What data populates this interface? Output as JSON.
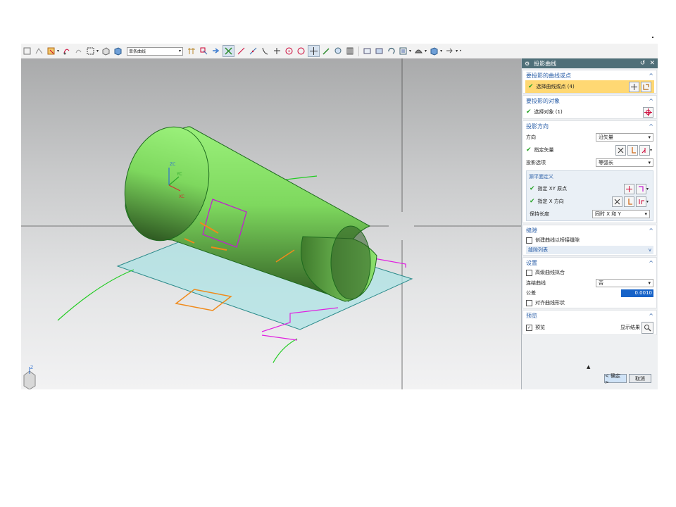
{
  "toolbar": {
    "curve_filter": "单条曲线",
    "icons": [
      "move-icon",
      "snap-icon",
      "select-icon",
      "rotate-icon",
      "redo-icon",
      "box-select-icon",
      "shading-icon",
      "cube-icon",
      "grid-icon",
      "snap-point-icon",
      "arrow-icon",
      "vertex-select-icon",
      "line-icon",
      "line2-icon",
      "curve-icon",
      "arc-icon",
      "circle-point-icon",
      "circle-icon",
      "cross-icon",
      "edit-icon",
      "refresh-icon",
      "layer-icon",
      "zoom-icon",
      "view-icon",
      "rotate-view-icon",
      "fit-icon",
      "render-icon",
      "box-icon",
      "more-icon"
    ]
  },
  "dialog": {
    "title": "投影曲线",
    "reset": "↺",
    "close": "✕",
    "section_curves": {
      "title": "要投影的曲线或点",
      "select_label": "选择曲线或点 (4)"
    },
    "section_objects": {
      "title": "要投影的对象",
      "select_label": "选择对象 (1)"
    },
    "section_direction": {
      "title": "投影方向",
      "direction_label": "方向",
      "direction_value": "沿矢量",
      "vector_label": "指定矢量",
      "options_label": "投影选项",
      "options_value": "等弧长",
      "subpanel": {
        "title": "源平面定义",
        "xy_origin_label": "指定 XY 原点",
        "x_dir_label": "指定 X 方向",
        "keep_len_label": "保持长度",
        "keep_len_value": "同时 X 和 Y"
      }
    },
    "section_gap": {
      "title": "缝隙",
      "bridge_label": "创建曲线以桥接缝隙",
      "list_label": "缝隙列表"
    },
    "section_settings": {
      "title": "设置",
      "hq_label": "高级曲线拟合",
      "join_label": "连结曲线",
      "join_value": "否",
      "tol_label": "公差",
      "tol_value": "0.0010",
      "align_label": "对齐曲线形状"
    },
    "section_preview": {
      "title": "预览",
      "preview_label": "预览",
      "show_result_label": "显示结果"
    },
    "ok": "< 确定 >",
    "cancel": "取消"
  },
  "viewport": {
    "triad_zc": "ZC",
    "triad_yc": "YC",
    "triad_xc": "XC",
    "corner_z": "Z"
  },
  "colors": {
    "header": "#4f6f78",
    "section_title": "#2b5fa8",
    "highlight": "#ffd873",
    "cone": "#7ed85e",
    "plane": "#aee3e4"
  }
}
